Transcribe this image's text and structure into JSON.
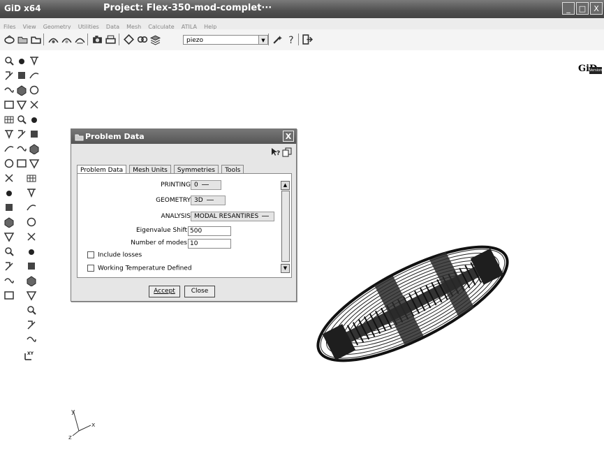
{
  "window": {
    "app_title": "GiD x64",
    "project_title": "Project: Flex-350-mod-complet···",
    "controls": [
      "_",
      "□",
      "X"
    ]
  },
  "menu": [
    "Files",
    "View",
    "Geometry",
    "Utilities",
    "Data",
    "Mesh",
    "Calculate",
    "ATILA",
    "Help"
  ],
  "toolbar": {
    "layer_value": "piezo",
    "logo_text": "GiD",
    "logo_version": "Version 9"
  },
  "dialog": {
    "title": "Problem Data",
    "close": "X",
    "tabs": [
      "Problem Data",
      "Mesh Units",
      "Symmetries",
      "Tools"
    ],
    "fields": {
      "printing_label": "PRINTING",
      "printing_value": "0",
      "geometry_label": "GEOMETRY",
      "geometry_value": "3D",
      "analysis_label": "ANALYSIS",
      "analysis_value": "MODAL RESANTIRES",
      "eigen_label": "Eigenvalue Shift",
      "eigen_value": "500",
      "modes_label": "Number of modes",
      "modes_value": "10"
    },
    "checkboxes": {
      "losses": "Include losses",
      "temperature": "Working Temperature Defined"
    },
    "buttons": {
      "accept": "Accept",
      "close": "Close"
    }
  },
  "axes": {
    "x": "x",
    "y": "y",
    "z": "z",
    "xy_label": "XY"
  }
}
